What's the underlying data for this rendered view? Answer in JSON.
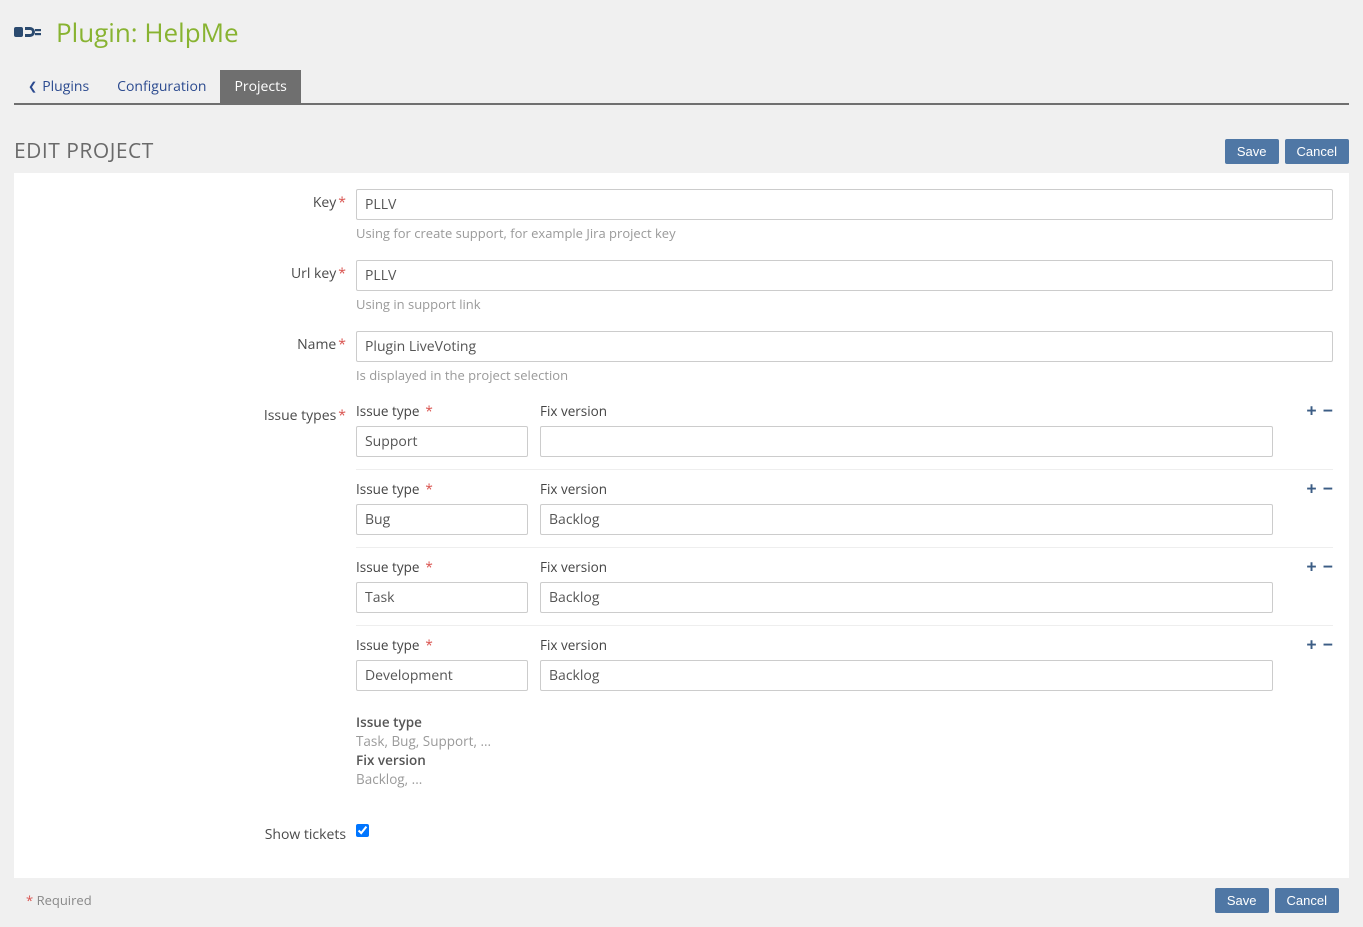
{
  "header": {
    "title": "Plugin: HelpMe"
  },
  "tabs": {
    "back_label": "Plugins",
    "config_label": "Configuration",
    "projects_label": "Projects"
  },
  "section": {
    "title": "EDIT PROJECT",
    "save_label": "Save",
    "cancel_label": "Cancel"
  },
  "form": {
    "key": {
      "label": "Key",
      "value": "PLLV",
      "help": "Using for create support, for example Jira project key"
    },
    "url_key": {
      "label": "Url key",
      "value": "PLLV",
      "help": "Using in support link"
    },
    "name": {
      "label": "Name",
      "value": "Plugin LiveVoting",
      "help": "Is displayed in the project selection"
    },
    "issue_types": {
      "label": "Issue types",
      "type_label": "Issue type",
      "fix_label": "Fix version",
      "rows": [
        {
          "type": "Support",
          "fix": ""
        },
        {
          "type": "Bug",
          "fix": "Backlog"
        },
        {
          "type": "Task",
          "fix": "Backlog"
        },
        {
          "type": "Development",
          "fix": "Backlog"
        }
      ],
      "legend_type_title": "Issue type",
      "legend_type_hint": "Task, Bug, Support, ...",
      "legend_fix_title": "Fix version",
      "legend_fix_hint": "Backlog, ..."
    },
    "show_tickets": {
      "label": "Show tickets",
      "checked": true
    }
  },
  "footer": {
    "required_note": "Required",
    "save_label": "Save",
    "cancel_label": "Cancel"
  }
}
